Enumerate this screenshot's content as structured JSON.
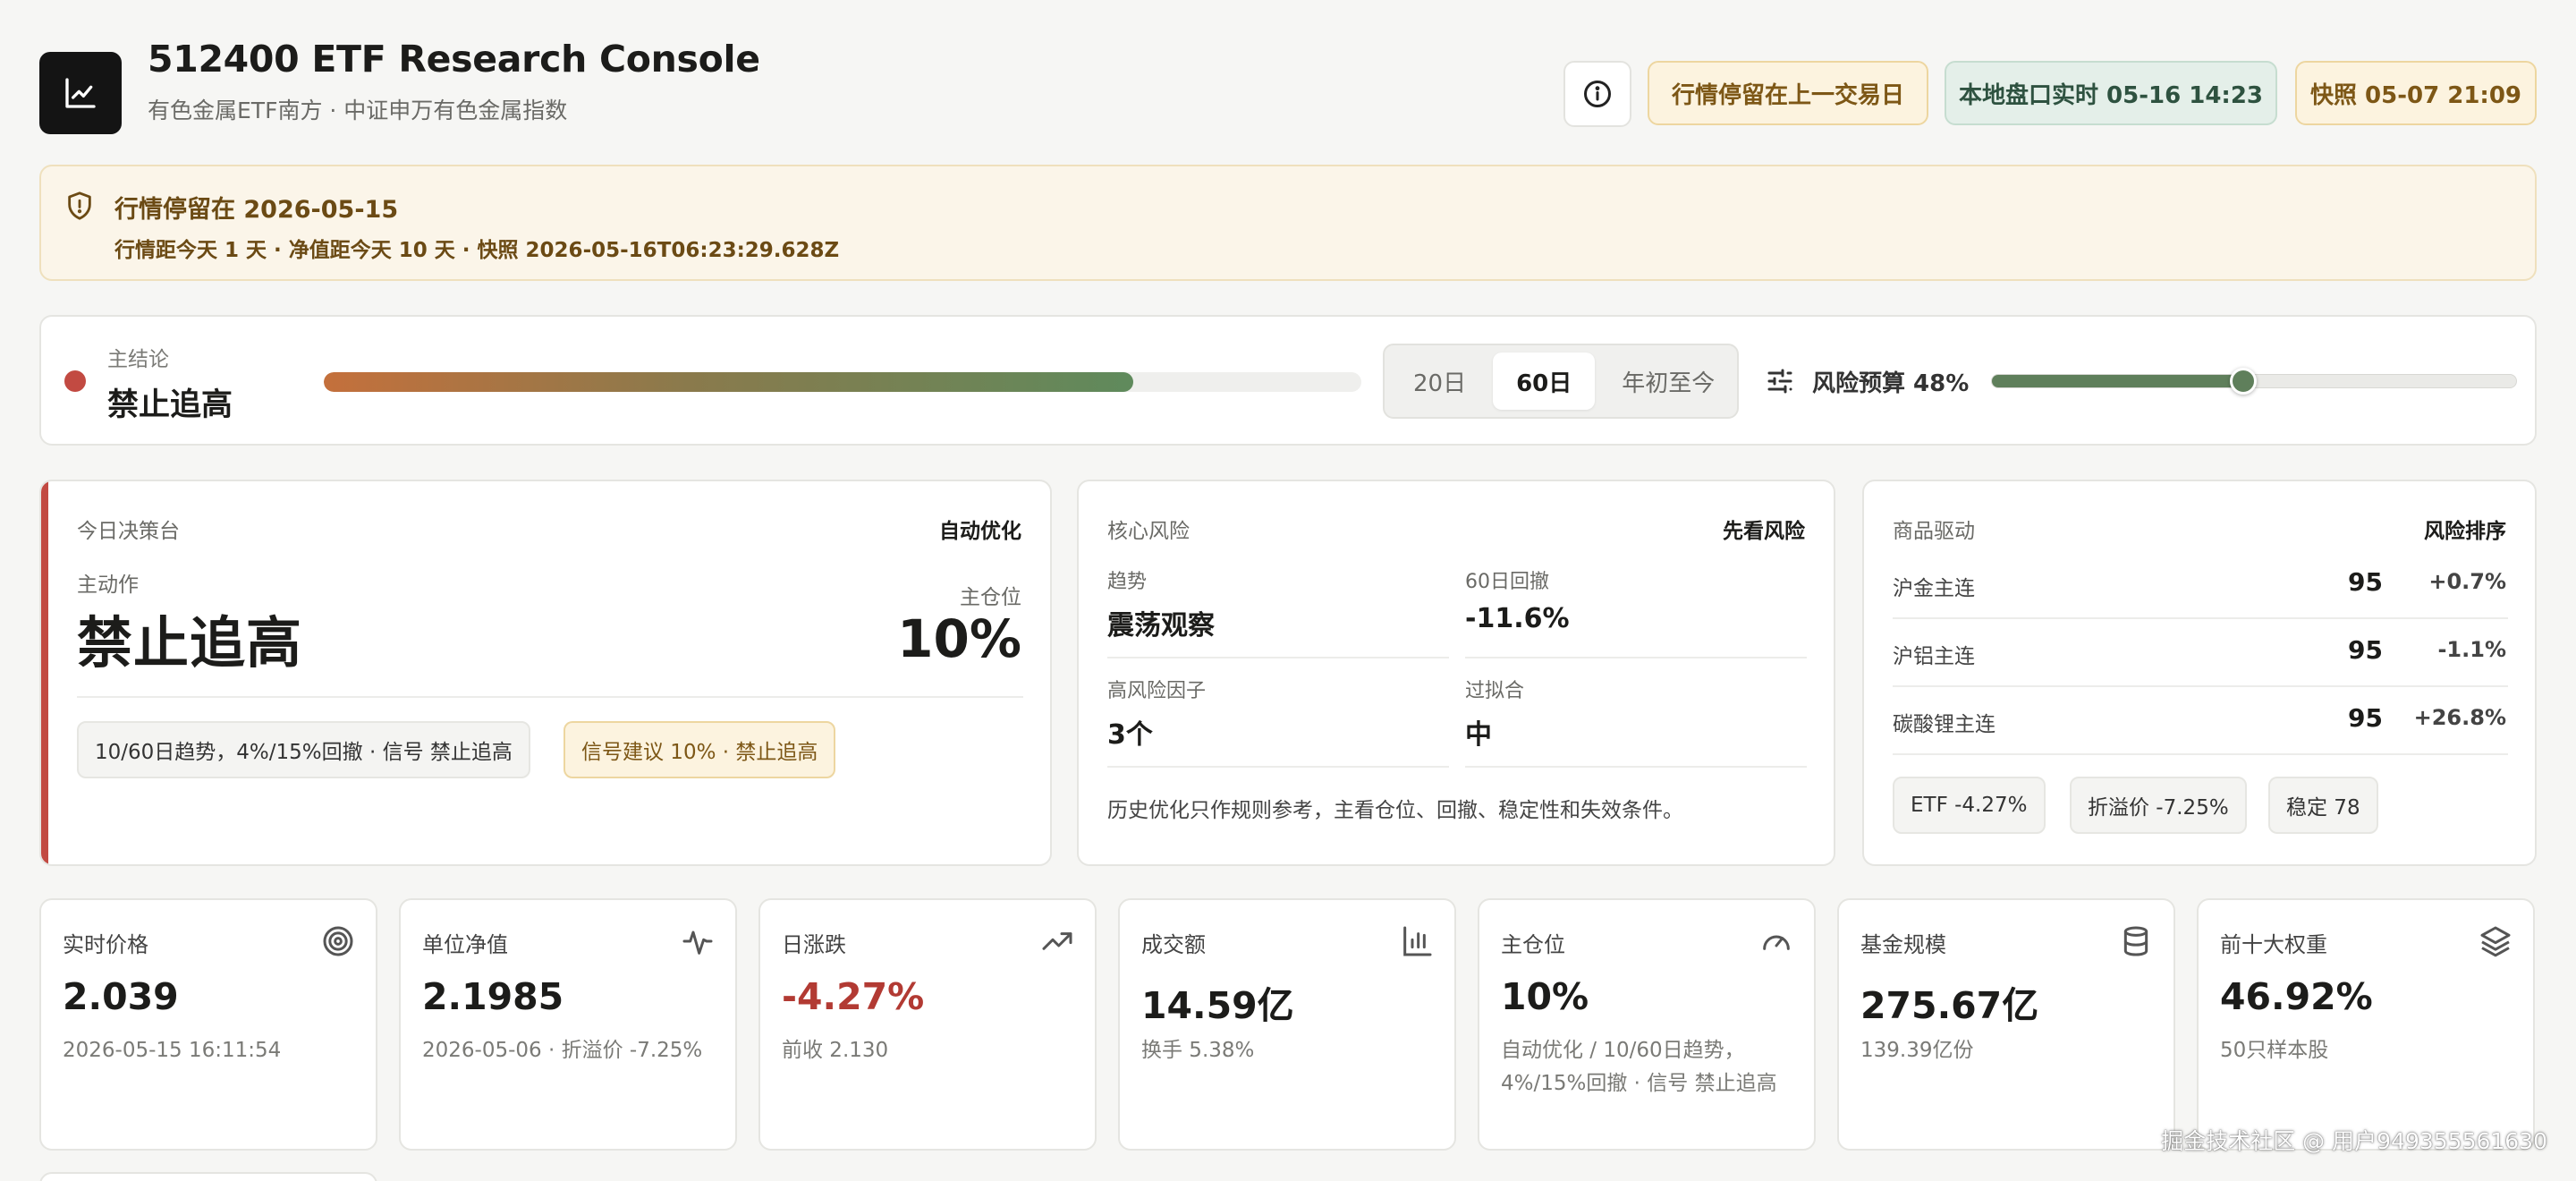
{
  "header": {
    "title": "512400 ETF Research Console",
    "subtitle": "有色金属ETF南方 · 中证申万有色金属指数",
    "badge_stale": "行情停留在上一交易日",
    "badge_live": "本地盘口实时 05-16 14:23",
    "badge_snapshot": "快照 05-07 21:09"
  },
  "banner": {
    "title": "行情停留在 2026-05-15",
    "detail": "行情距今天 1 天 · 净值距今天 10 天 · 快照 2026-05-16T06:23:29.628Z"
  },
  "conclusion": {
    "label": "主结论",
    "value": "禁止追高",
    "progress": 0.78,
    "ranges": [
      "20日",
      "60日",
      "年初至今"
    ],
    "active_range": "60日",
    "risk_budget_label": "风险预算 48%",
    "risk_budget": 0.48
  },
  "decision": {
    "title": "今日决策台",
    "tag": "自动优化",
    "action_label": "主动作",
    "action": "禁止追高",
    "position_label": "主仓位",
    "position": "10%",
    "chip_signal": "10/60日趋势，4%/15%回撤 · 信号 禁止追高",
    "chip_advice": "信号建议 10% · 禁止追高"
  },
  "risk": {
    "title": "核心风险",
    "tag": "先看风险",
    "items": [
      {
        "label": "趋势",
        "value": "震荡观察"
      },
      {
        "label": "60日回撤",
        "value": "-11.6%"
      },
      {
        "label": "高风险因子",
        "value": "3个"
      },
      {
        "label": "过拟合",
        "value": "中"
      }
    ],
    "note": "历史优化只作规则参考，主看仓位、回撤、稳定性和失效条件。"
  },
  "drivers": {
    "title": "商品驱动",
    "tag": "风险排序",
    "rows": [
      {
        "name": "沪金主连",
        "score": "95",
        "change": "+0.7%"
      },
      {
        "name": "沪铝主连",
        "score": "95",
        "change": "-1.1%"
      },
      {
        "name": "碳酸锂主连",
        "score": "95",
        "change": "+26.8%"
      }
    ],
    "chips": [
      "ETF -4.27%",
      "折溢价 -7.25%",
      "稳定 78"
    ]
  },
  "cards": [
    {
      "label": "实时价格",
      "value": "2.039",
      "sub": "2026-05-15 16:11:54",
      "icon": "target-icon"
    },
    {
      "label": "单位净值",
      "value": "2.1985",
      "sub": "2026-05-06 · 折溢价 -7.25%",
      "icon": "pulse-icon"
    },
    {
      "label": "日涨跌",
      "value": "-4.27%",
      "sub": "前收 2.130",
      "icon": "trending-up-icon"
    },
    {
      "label": "成交额",
      "value": "14.59亿",
      "sub": "换手 5.38%",
      "icon": "bar-chart-icon"
    },
    {
      "label": "主仓位",
      "value": "10%",
      "sub": "自动优化 / 10/60日趋势，4%/15%回撤 · 信号 禁止追高",
      "icon": "gauge-icon"
    },
    {
      "label": "基金规模",
      "value": "275.67亿",
      "sub": "139.39亿份",
      "icon": "database-icon"
    },
    {
      "label": "前十大权重",
      "value": "46.92%",
      "sub": "50只样本股",
      "icon": "layers-icon"
    }
  ],
  "colors": {
    "danger": "#c24a42",
    "amber_bg": "#fcf3df",
    "green": "#5f7f5b",
    "dark": "#141414"
  },
  "watermark": "掘金技术社区 @ 用户949355561630"
}
